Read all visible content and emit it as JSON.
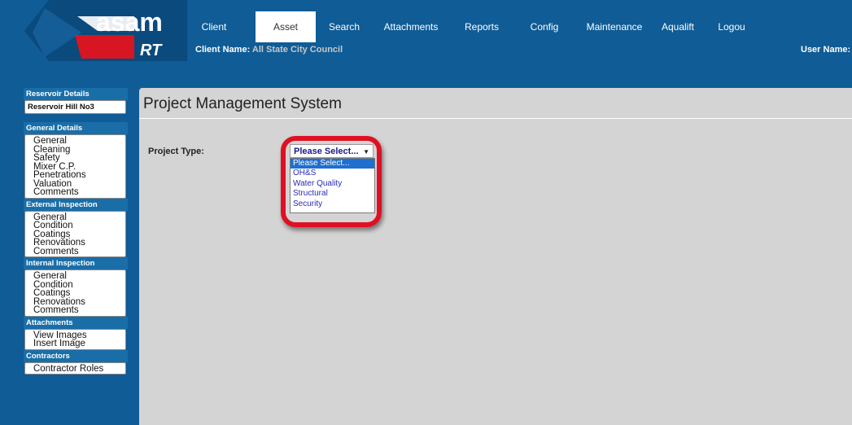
{
  "app": {
    "logo_text": "asam",
    "logo_sub": "RT"
  },
  "nav": {
    "tabs": [
      {
        "label": "Client",
        "active": false
      },
      {
        "label": "Asset",
        "active": true
      },
      {
        "label": "Search",
        "active": false
      },
      {
        "label": "Attachments",
        "active": false
      },
      {
        "label": "Reports",
        "active": false
      },
      {
        "label": "Config",
        "active": false
      },
      {
        "label": "Maintenance",
        "active": false
      },
      {
        "label": "Aqualift",
        "active": false
      },
      {
        "label": "Logou",
        "active": false
      }
    ]
  },
  "header": {
    "client_label": "Client Name:",
    "client_value": "All State City Council",
    "user_label": "User Name:"
  },
  "sidebar": {
    "reservoir_head": "Reservoir Details",
    "reservoir_name": "Reservoir Hill No3",
    "general_head": "General Details",
    "general_items": [
      "General",
      "Cleaning",
      "Safety",
      "Mixer C.P.",
      "Penetrations",
      "Valuation",
      "Comments"
    ],
    "external_head": "External Inspection",
    "external_items": [
      "General",
      "Condition",
      "Coatings",
      "Renovations",
      "Comments"
    ],
    "internal_head": "Internal Inspection",
    "internal_items": [
      "General",
      "Condition",
      "Coatings",
      "Renovations",
      "Comments"
    ],
    "attachments_head": "Attachments",
    "attachments_items": [
      "View Images",
      "Insert Image"
    ],
    "contractors_head": "Contractors",
    "contractors_items": [
      "Contractor Roles"
    ]
  },
  "main": {
    "title": "Project Management System",
    "project_type_label": "Project Type:",
    "select_value": "Please Select...",
    "options": [
      "Please Select...",
      "OH&S",
      "Water Quality",
      "Structural",
      "Security"
    ]
  },
  "colors": {
    "header_bg": "#0f5c96",
    "highlight": "#e01023",
    "content_bg": "#d4d4d4"
  }
}
